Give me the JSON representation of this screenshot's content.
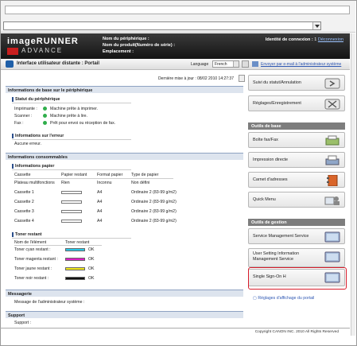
{
  "header": {
    "logo_line1": "imageRUNNER",
    "logo_line2": "ADVANCE",
    "device_name_label": "Nom du périphérique :",
    "product_name_label": "Nom du produit(Numéro de série) :",
    "location_label": "Emplacement :",
    "login_id_label": "Identité de connexion :",
    "login_id_value": "1",
    "logout_link": "Déconnexion"
  },
  "portal_bar": {
    "title": "Interface utilisateur distante : Portail",
    "language_label": "Language",
    "language_value": "French",
    "email_link": "Envoyer par e-mail à l'administrateur système"
  },
  "main": {
    "last_update": "Dernière mise à jour : 08/02 2010 14:27:37",
    "basic_info_header": "Informations de base sur le périphérique",
    "device_status_header": "Statut du périphérique",
    "status_rows": [
      {
        "label": "Imprimante :",
        "value": "Machine prête à imprimer."
      },
      {
        "label": "Scanner :",
        "value": "Machine prête à lire."
      },
      {
        "label": "Fax :",
        "value": "Prêt pour envoi ou réception de fax."
      }
    ],
    "error_header": "Informations sur l'erreur",
    "error_value": "Aucune erreur.",
    "consumables_header": "Informations consommables",
    "paper_header": "Informations papier",
    "paper_columns": [
      "Cassette",
      "Papier restant",
      "Format papier",
      "Type de papier"
    ],
    "paper_rows": [
      {
        "cassette": "Plateau multifonctions",
        "remaining": "Rien",
        "format": "Inconnu",
        "type": "Non défini"
      },
      {
        "cassette": "Cassette 1",
        "remaining": "",
        "format": "A4",
        "type": "Ordinaire 2 (83-99 g/m2)"
      },
      {
        "cassette": "Cassette 2",
        "remaining": "",
        "format": "A4",
        "type": "Ordinaire 2 (83-99 g/m2)"
      },
      {
        "cassette": "Cassette 3",
        "remaining": "",
        "format": "A4",
        "type": "Ordinaire 2 (83-99 g/m2)"
      },
      {
        "cassette": "Cassette 4",
        "remaining": "",
        "format": "A4",
        "type": "Ordinaire 2 (83-99 g/m2)"
      }
    ],
    "toner_header": "Toner restant",
    "toner_columns": [
      "Nom de l'élément",
      "Toner restant"
    ],
    "toner_rows": [
      {
        "name": "Toner cyan restant :",
        "status": "OK",
        "color": "#28c8e8"
      },
      {
        "name": "Toner magenta restant :",
        "status": "OK",
        "color": "#e020c8"
      },
      {
        "name": "Toner jaune restant :",
        "status": "OK",
        "color": "#f0e81c"
      },
      {
        "name": "Toner noir restant :",
        "status": "OK",
        "color": "#111111"
      }
    ],
    "message_header": "Messagerie",
    "message_label": "Message de l'administrateur système :",
    "support_header": "Support",
    "support_label": "Support :"
  },
  "sidebar": {
    "status_button": "Suivi du statut/Annulation",
    "settings_button": "Réglages/Enregistrement",
    "basic_tools_header": "Outils de base",
    "basic_tools": [
      "Boîte fax/Fax",
      "Impression directe",
      "Carnet d'adresses",
      "Quick Menu"
    ],
    "management_header": "Outils de gestion",
    "management_tools": [
      "Service Management Service",
      "User Setting Information Management Service",
      "Single Sign-On H"
    ],
    "display_settings_link": "Réglages d'affichage du portail"
  },
  "footer": {
    "copyright": "Copyright CANON INC. 2010 All Rights Reserved"
  }
}
